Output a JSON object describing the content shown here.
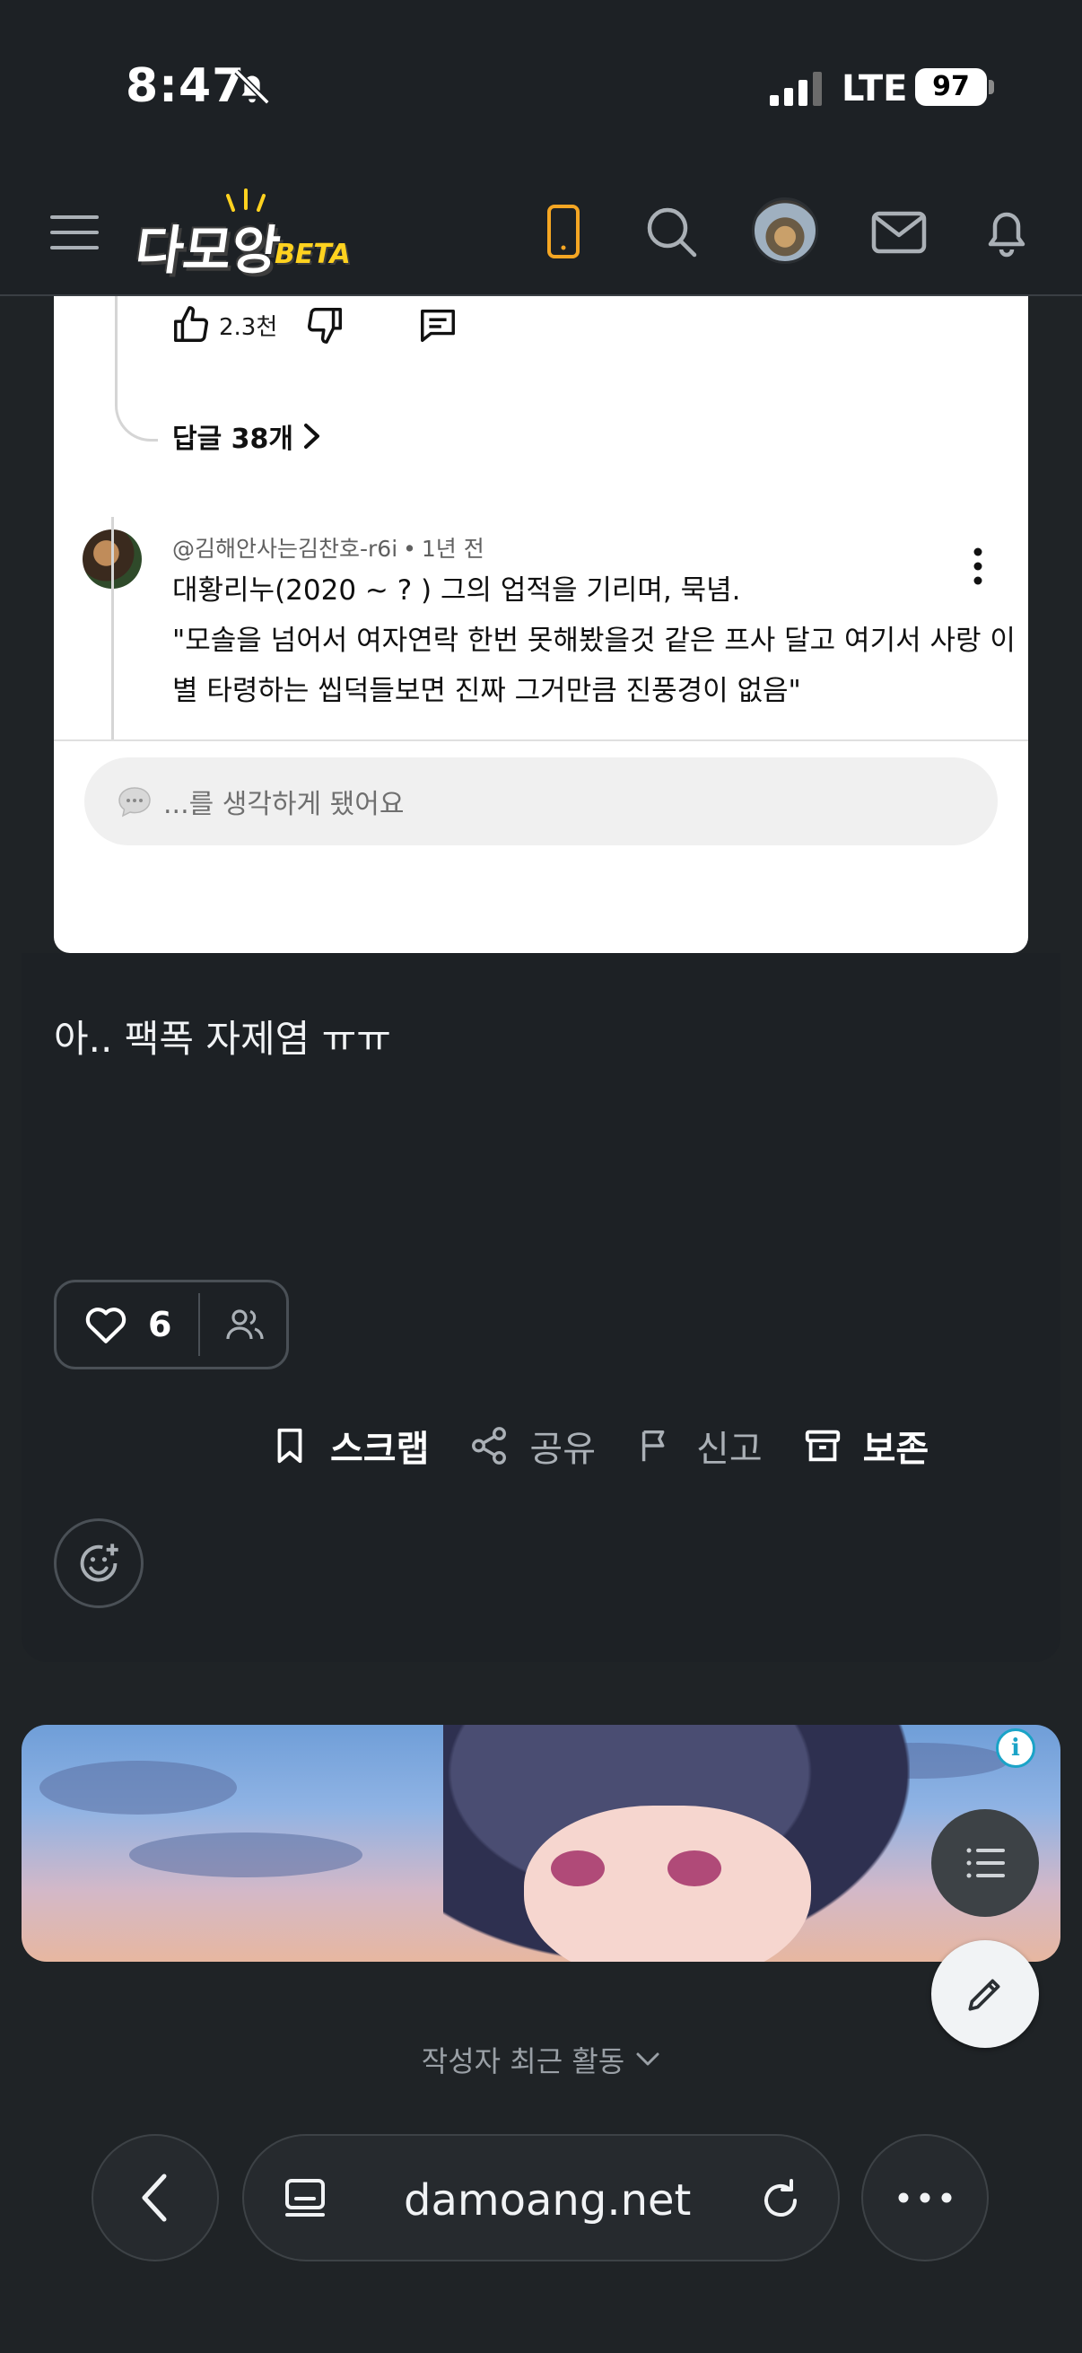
{
  "status": {
    "time": "8:47",
    "network": "LTE",
    "battery": "97"
  },
  "header": {
    "logo_text": "다모앙",
    "logo_badge": "BETA"
  },
  "embedded_comments": {
    "like_count": "2.3천",
    "replies_label": "답글 38개",
    "comment": {
      "author": "@김해안사는김찬호-r6i",
      "time": "1년 전",
      "line1": "대황리누(2020 ~ ? ) 그의 업적을 기리며, 묵념.",
      "line2": "\"모솔을 넘어서 여자연락 한번 못해봤을것 같은 프사 달고 여기서 사랑 이별 타령하는 씹덕들보면 진짜 그거만큼 진풍경이 없음\""
    },
    "input_placeholder": "...를 생각하게 됐어요"
  },
  "post": {
    "body": "아.. 팩폭 자제염 ㅠㅠ",
    "like_count": "6",
    "actions": {
      "scrap": "스크랩",
      "share": "공유",
      "report": "신고",
      "archive": "보존"
    }
  },
  "author_activity": "작성자 최근 활동",
  "browser": {
    "url": "damoang.net"
  },
  "colors": {
    "accent_phone": "#f5a623",
    "logo_badge": "#ffd21f",
    "background": "#1f2326"
  }
}
